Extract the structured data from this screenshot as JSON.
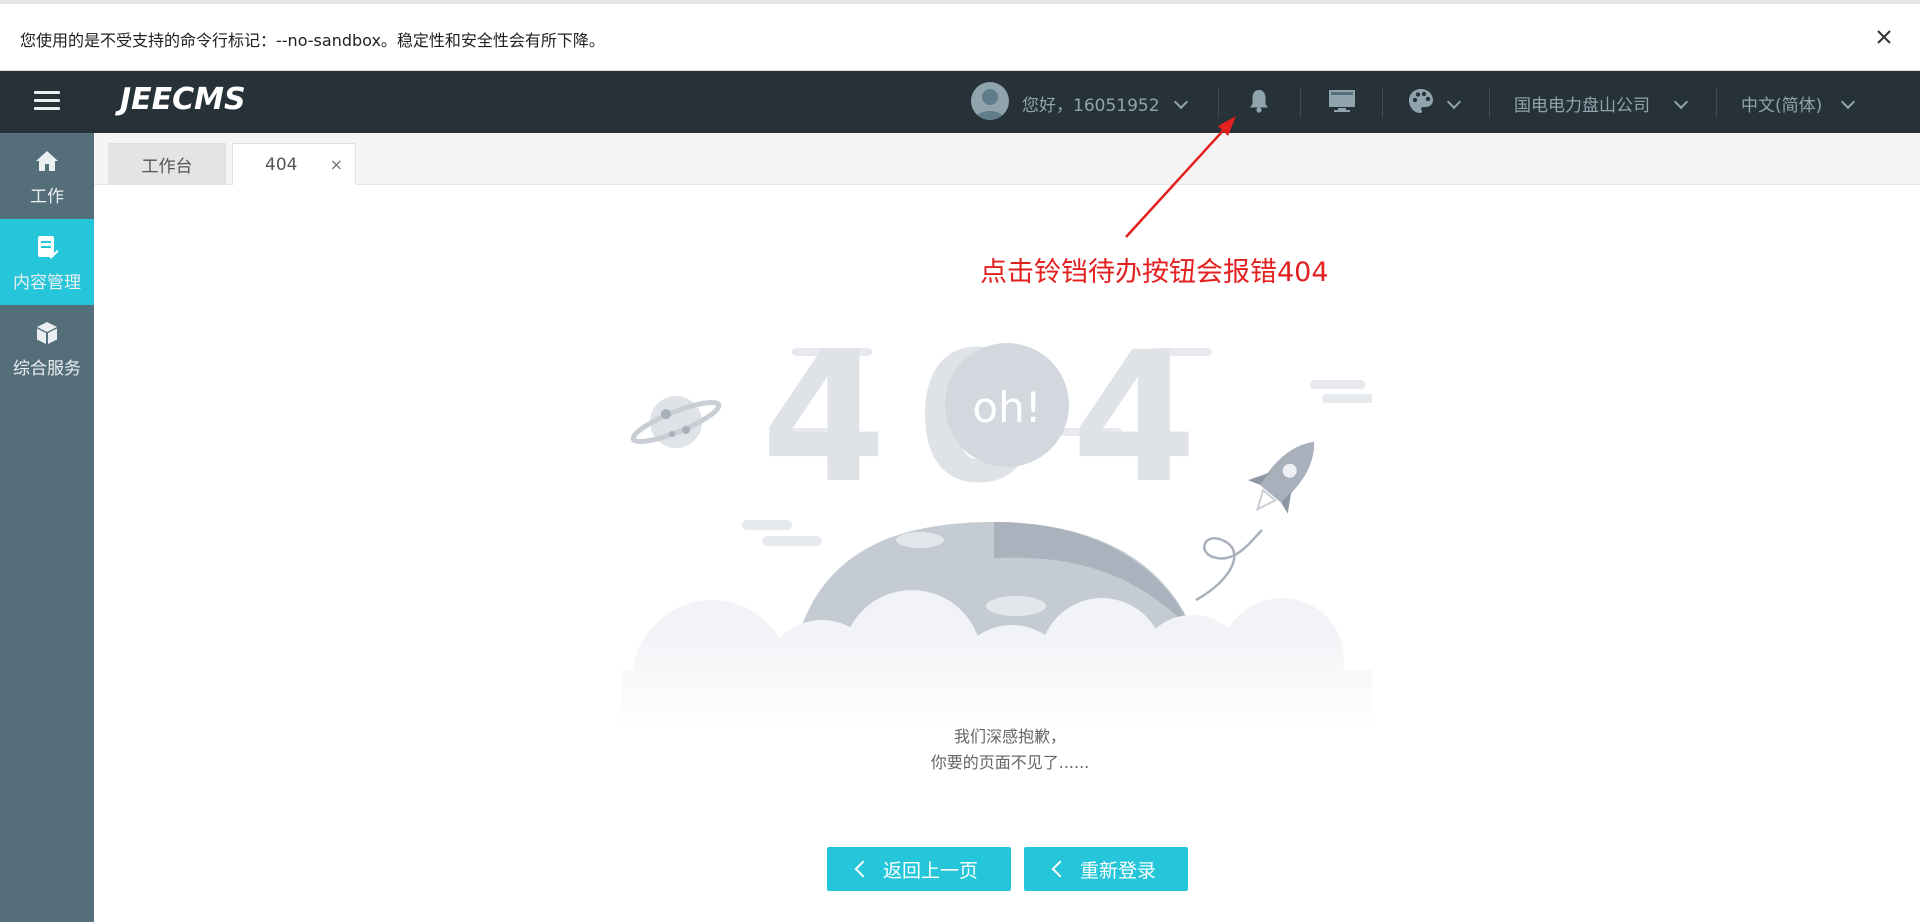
{
  "infobar": {
    "message": "您使用的是不受支持的命令行标记：--no-sandbox。稳定性和安全性会有所下降。"
  },
  "header": {
    "logo": "JEECMS",
    "greeting": "您好，16051952",
    "company": "国电电力盘山公司",
    "language": "中文(简体)"
  },
  "sidebar": {
    "items": [
      {
        "label": "工作",
        "icon": "home-icon"
      },
      {
        "label": "内容管理",
        "icon": "document-icon"
      },
      {
        "label": "综合服务",
        "icon": "cube-icon"
      }
    ],
    "active_index": 1
  },
  "tabs": [
    {
      "label": "工作台"
    },
    {
      "label": "404",
      "close": "×"
    }
  ],
  "annotation": "点击铃铛待办按钮会报错404",
  "illustration": {
    "big_text": "404",
    "bubble_text": "oh!"
  },
  "error": {
    "line1": "我们深感抱歉，",
    "line2": "你要的页面不见了......"
  },
  "buttons": {
    "back": "返回上一页",
    "relogin": "重新登录"
  },
  "colors": {
    "topbar": "#263238",
    "sidebar": "#546e7a",
    "accent": "#26c6da",
    "annotation": "#e32020"
  }
}
